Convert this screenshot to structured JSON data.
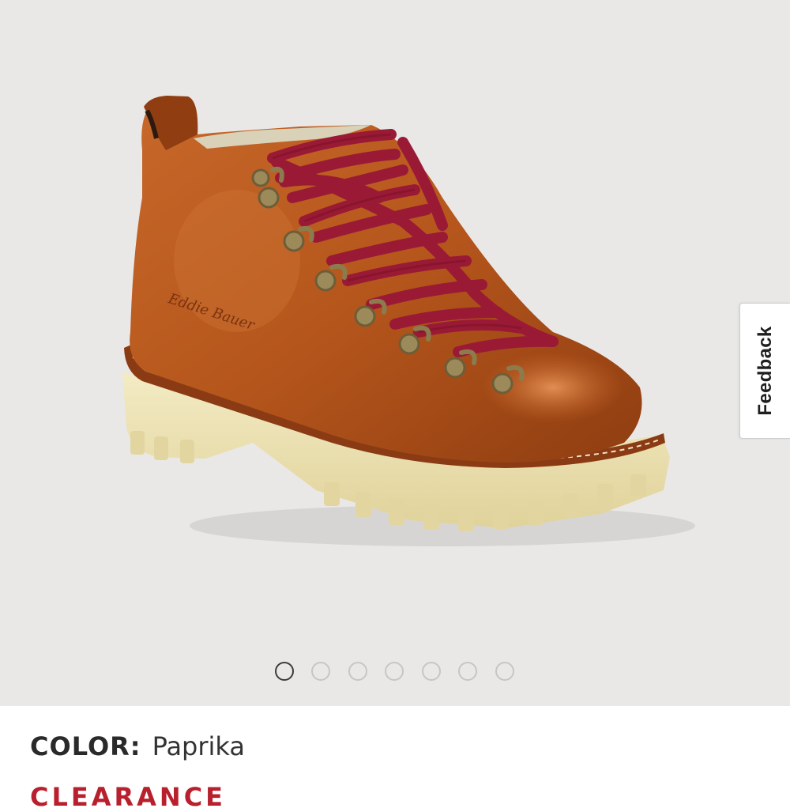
{
  "gallery": {
    "slide_count": 7,
    "active_index": 0,
    "image_alt": "Brown leather hiking boot with red laces"
  },
  "feedback": {
    "label": "Feedback"
  },
  "product": {
    "color_label": "COLOR:",
    "color_value": "Paprika",
    "badge": "CLEARANCE"
  },
  "colors": {
    "gallery_bg": "#e9e8e7",
    "leather": "#b5561c",
    "laces": "#9a1a35",
    "sole": "#eadfae",
    "clearance_red": "#b8202e"
  }
}
